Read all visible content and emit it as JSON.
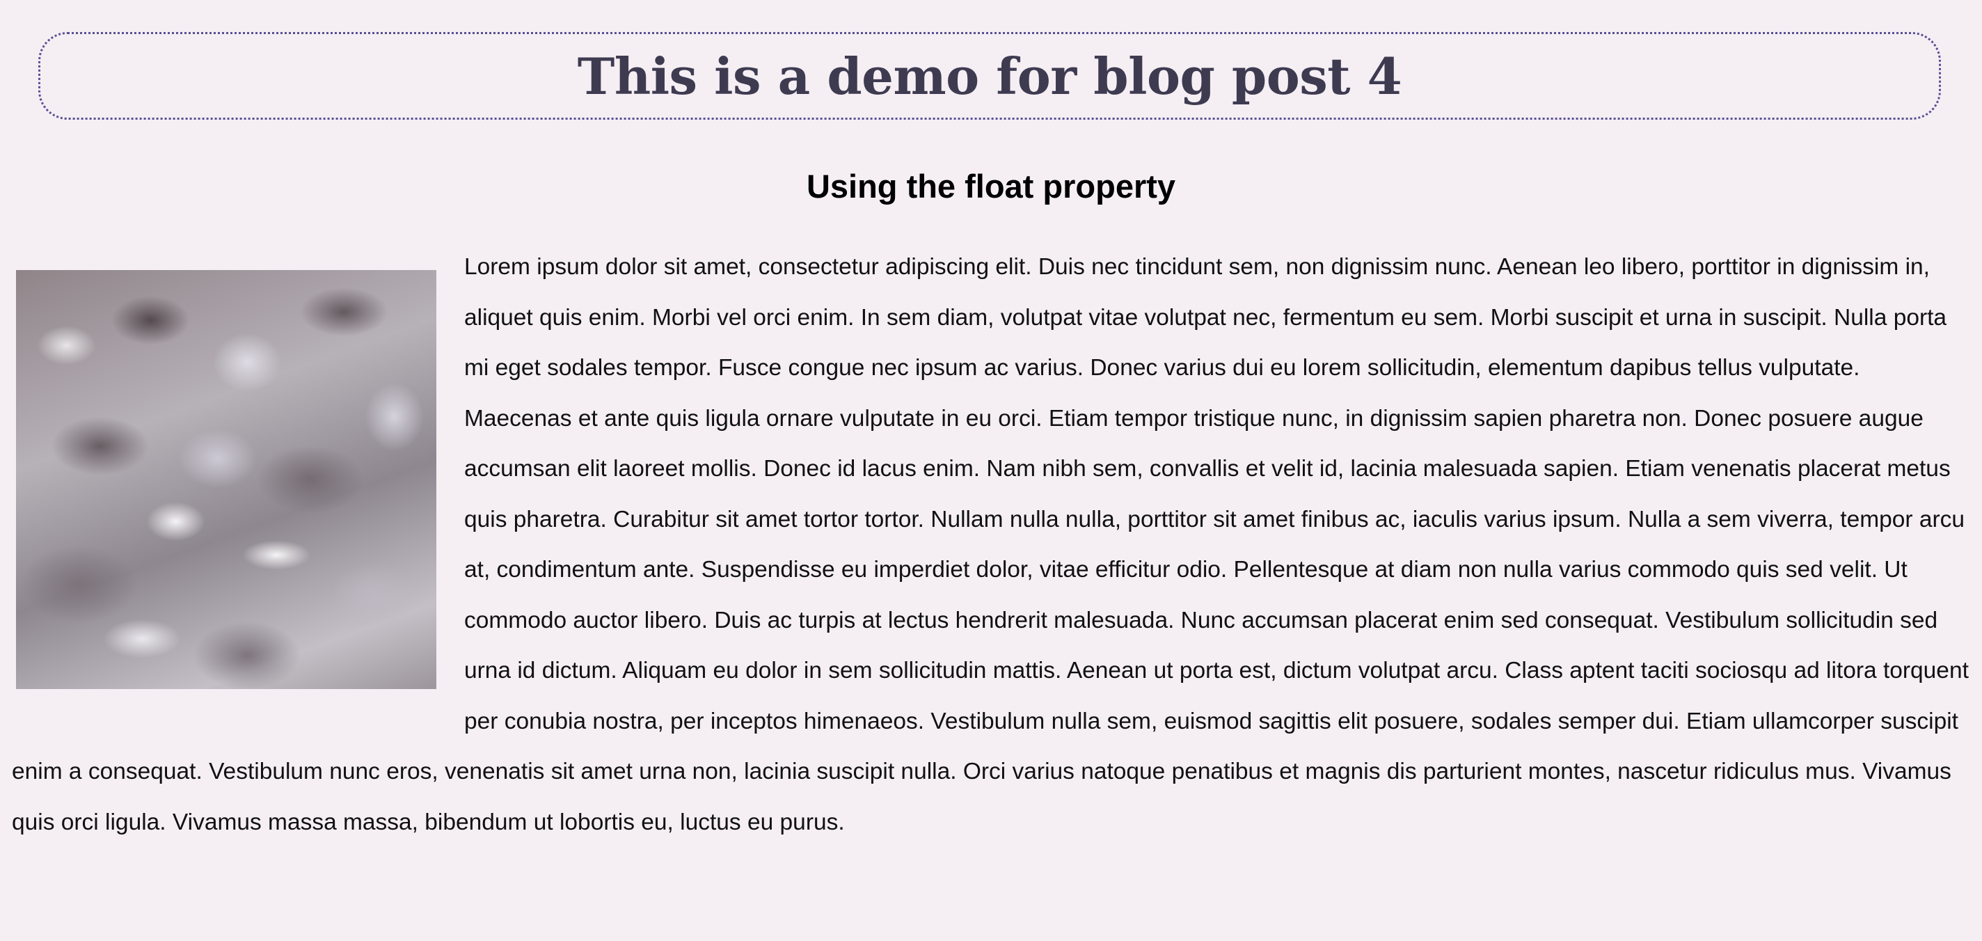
{
  "header": {
    "title": "This is a demo for blog post 4"
  },
  "section": {
    "subtitle": "Using the float property"
  },
  "article": {
    "image_alt": "water texture image",
    "paragraph": "Lorem ipsum dolor sit amet, consectetur adipiscing elit. Duis nec tincidunt sem, non dignissim nunc. Aenean leo libero, porttitor in dignissim in, aliquet quis enim. Morbi vel orci enim. In sem diam, volutpat vitae volutpat nec, fermentum eu sem. Morbi suscipit et urna in suscipit. Nulla porta mi eget sodales tempor. Fusce congue nec ipsum ac varius. Donec varius dui eu lorem sollicitudin, elementum dapibus tellus vulputate. Maecenas et ante quis ligula ornare vulputate in eu orci. Etiam tempor tristique nunc, in dignissim sapien pharetra non. Donec posuere augue accumsan elit laoreet mollis. Donec id lacus enim. Nam nibh sem, convallis et velit id, lacinia malesuada sapien. Etiam venenatis placerat metus quis pharetra. Curabitur sit amet tortor tortor. Nullam nulla nulla, porttitor sit amet finibus ac, iaculis varius ipsum. Nulla a sem viverra, tempor arcu at, condimentum ante. Suspendisse eu imperdiet dolor, vitae efficitur odio. Pellentesque at diam non nulla varius commodo quis sed velit. Ut commodo auctor libero. Duis ac turpis at lectus hendrerit malesuada. Nunc accumsan placerat enim sed consequat. Vestibulum sollicitudin sed urna id dictum. Aliquam eu dolor in sem sollicitudin mattis. Aenean ut porta est, dictum volutpat arcu. Class aptent taciti sociosqu ad litora torquent per conubia nostra, per inceptos himenaeos. Vestibulum nulla sem, euismod sagittis elit posuere, sodales semper dui. Etiam ullamcorper suscipit enim a consequat. Vestibulum nunc eros, venenatis sit amet urna non, lacinia suscipit nulla. Orci varius natoque penatibus et magnis dis parturient montes, nascetur ridiculus mus. Vivamus quis orci ligula. Vivamus massa massa, bibendum ut lobortis eu, luctus eu purus."
  },
  "colors": {
    "background": "#f5eff4",
    "title": "#3e3b51",
    "title_border": "#5a4f94",
    "text": "#111111"
  }
}
